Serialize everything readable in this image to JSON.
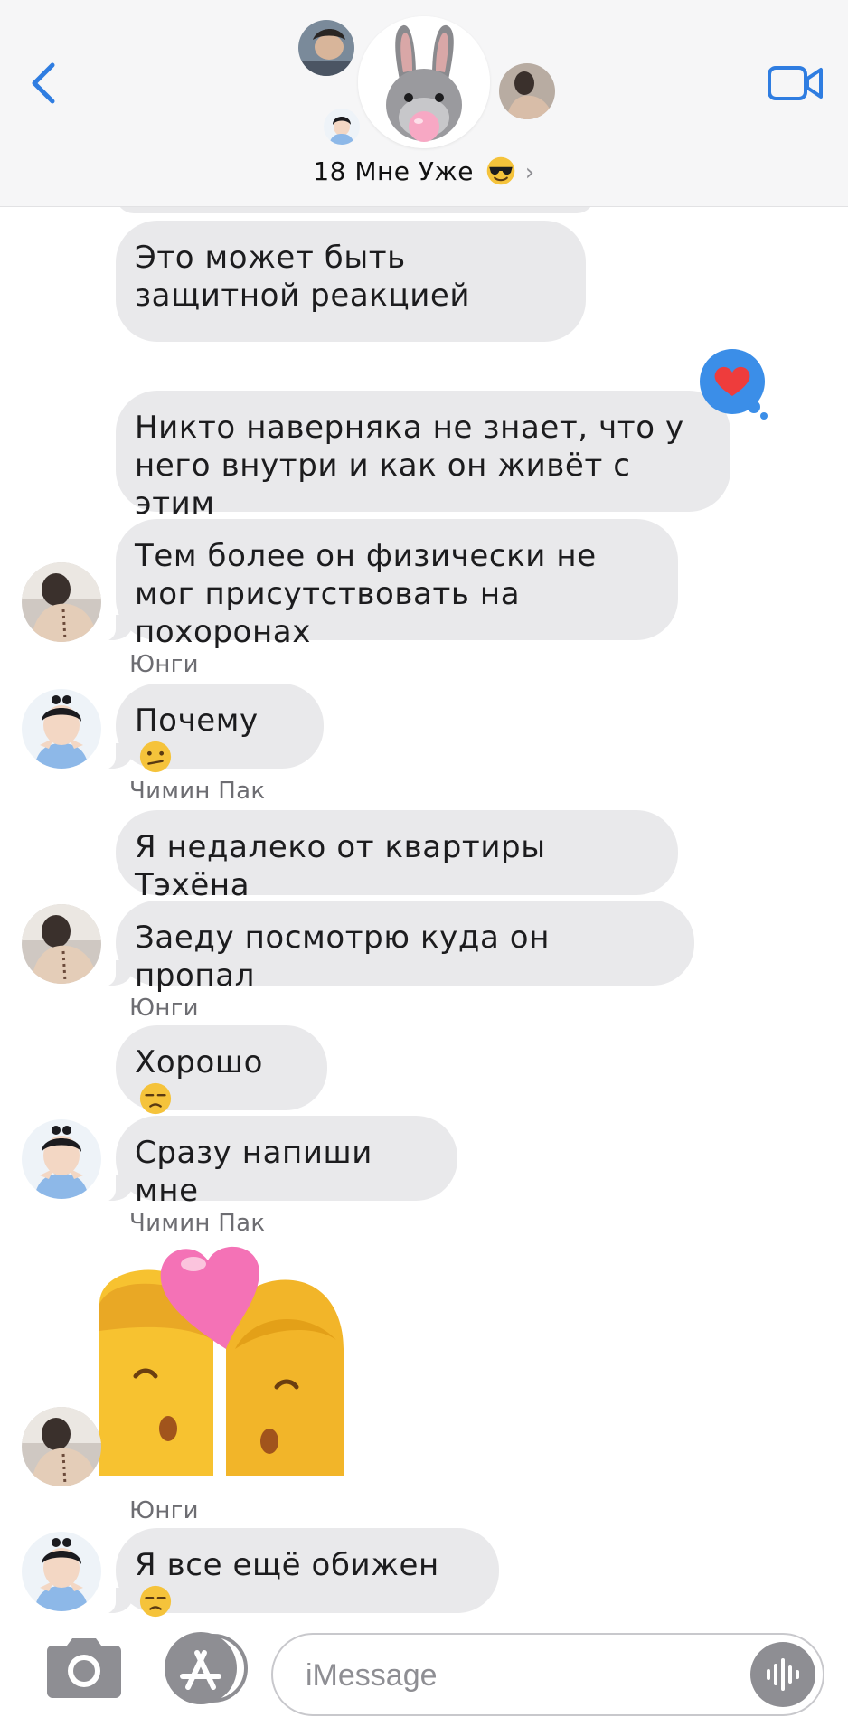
{
  "header": {
    "group_name": "18 Мне Уже",
    "group_emoji": "smiling-face-with-sunglasses",
    "chevron": "›",
    "accent_color": "#2f7de1"
  },
  "messages": {
    "m1": "Это может быть защитной реакцией",
    "m2": "Никто наверняка не знает,  что у него внутри  и как он живёт с этим",
    "m3": "Тем более он физически не мог присутствовать на похоронах",
    "m4": "Почему",
    "m5": "Я недалеко от квартиры Тэхёна",
    "m6": "Заеду посмотрю куда он пропал",
    "m7": "Хорошо",
    "m8": "Сразу напиши мне",
    "m10": "Я все ещё обижен"
  },
  "senders": {
    "s1": "Юнги",
    "s2": "Чимин Пак",
    "s3": "Юнги",
    "s4": "Чимин Пак",
    "s5": "Юнги"
  },
  "reaction": {
    "type": "heart",
    "color": "#3b8ee8"
  },
  "input": {
    "placeholder": "iMessage"
  },
  "colors": {
    "bubble": "#e9e9eb",
    "sender_text": "#6d6d72",
    "icon_gray": "#8e8e93"
  }
}
